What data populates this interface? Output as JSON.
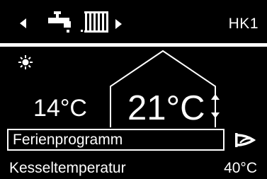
{
  "header": {
    "nav_left_icon": "triangle-left-icon",
    "tap_icon": "water-tap-icon",
    "radiator_icon": "radiator-icon",
    "nav_right_icon": "triangle-right-icon",
    "circuit_label": "HK1"
  },
  "main": {
    "mode_icon": "sun-icon",
    "outside_temperature": "14°C",
    "room_temperature": "21°C",
    "adjust_icon": "up-down-arrows-icon"
  },
  "program": {
    "label": "Ferienprogramm",
    "icon": "holiday-program-icon"
  },
  "info": {
    "label": "Kesseltemperatur",
    "value": "40°C"
  },
  "colors": {
    "background": "#000000",
    "foreground": "#ffffff"
  }
}
